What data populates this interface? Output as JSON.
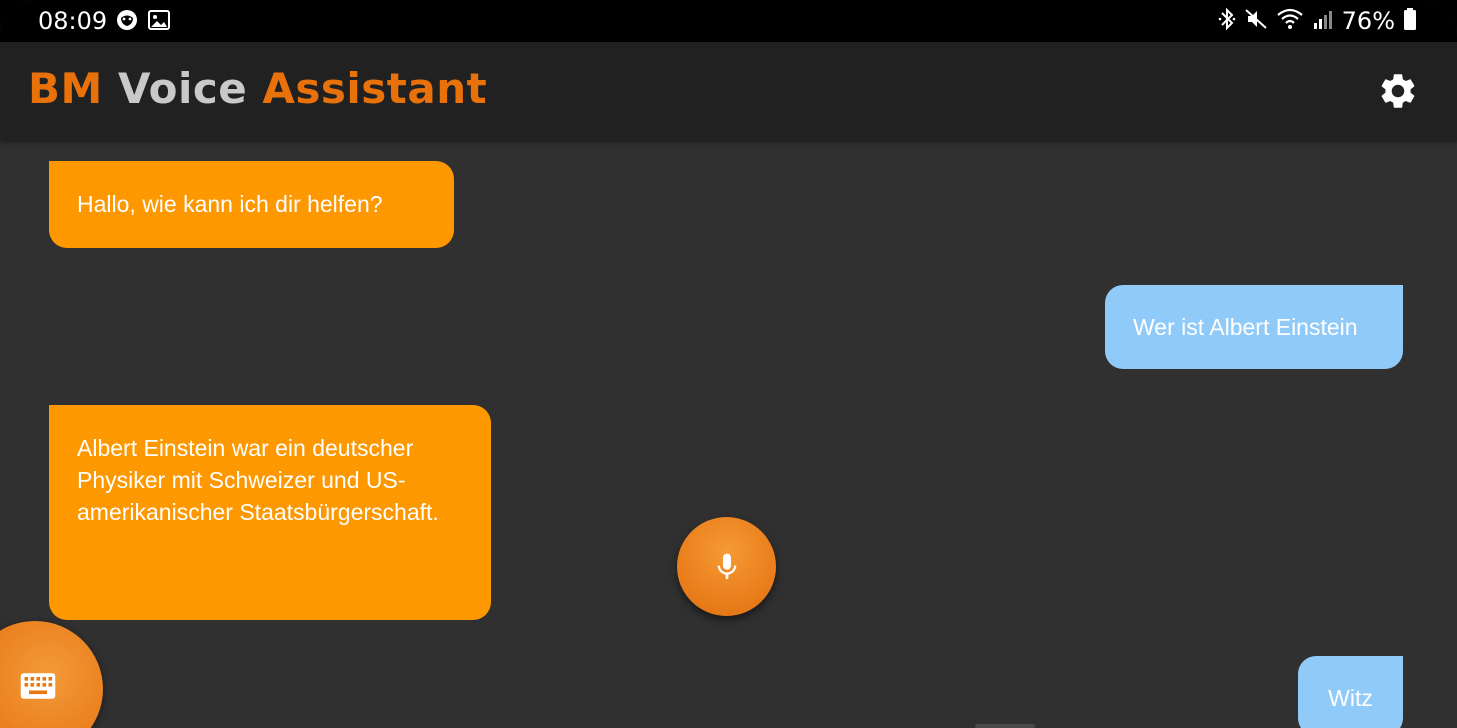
{
  "status_bar": {
    "time": "08:09",
    "battery": "76%",
    "left_icons": [
      "face-icon",
      "image-icon"
    ],
    "right_icons": [
      "bluetooth-icon",
      "mute-icon",
      "wifi-icon",
      "signal-icon",
      "battery-icon"
    ]
  },
  "app_bar": {
    "title_part1": "BM",
    "title_part2": "Voice",
    "title_part3": "Assistant",
    "settings_icon": "gear-icon"
  },
  "chat": {
    "messages": [
      {
        "from": "bot",
        "text": "Hallo, wie kann ich dir helfen?"
      },
      {
        "from": "user",
        "text": "Wer ist Albert Einstein"
      },
      {
        "from": "bot",
        "text": "Albert Einstein war ein deutscher Physiker mit Schweizer und US-amerikanischer Staatsbürgerschaft."
      },
      {
        "from": "user",
        "text": "Witz"
      }
    ]
  },
  "buttons": {
    "mic_icon": "microphone-icon",
    "keyboard_icon": "keyboard-icon"
  },
  "colors": {
    "accent_orange": "#e8710a",
    "bot_bubble": "#fe9800",
    "user_bubble": "#90caf9",
    "background": "#303030",
    "app_bar": "#212121"
  }
}
